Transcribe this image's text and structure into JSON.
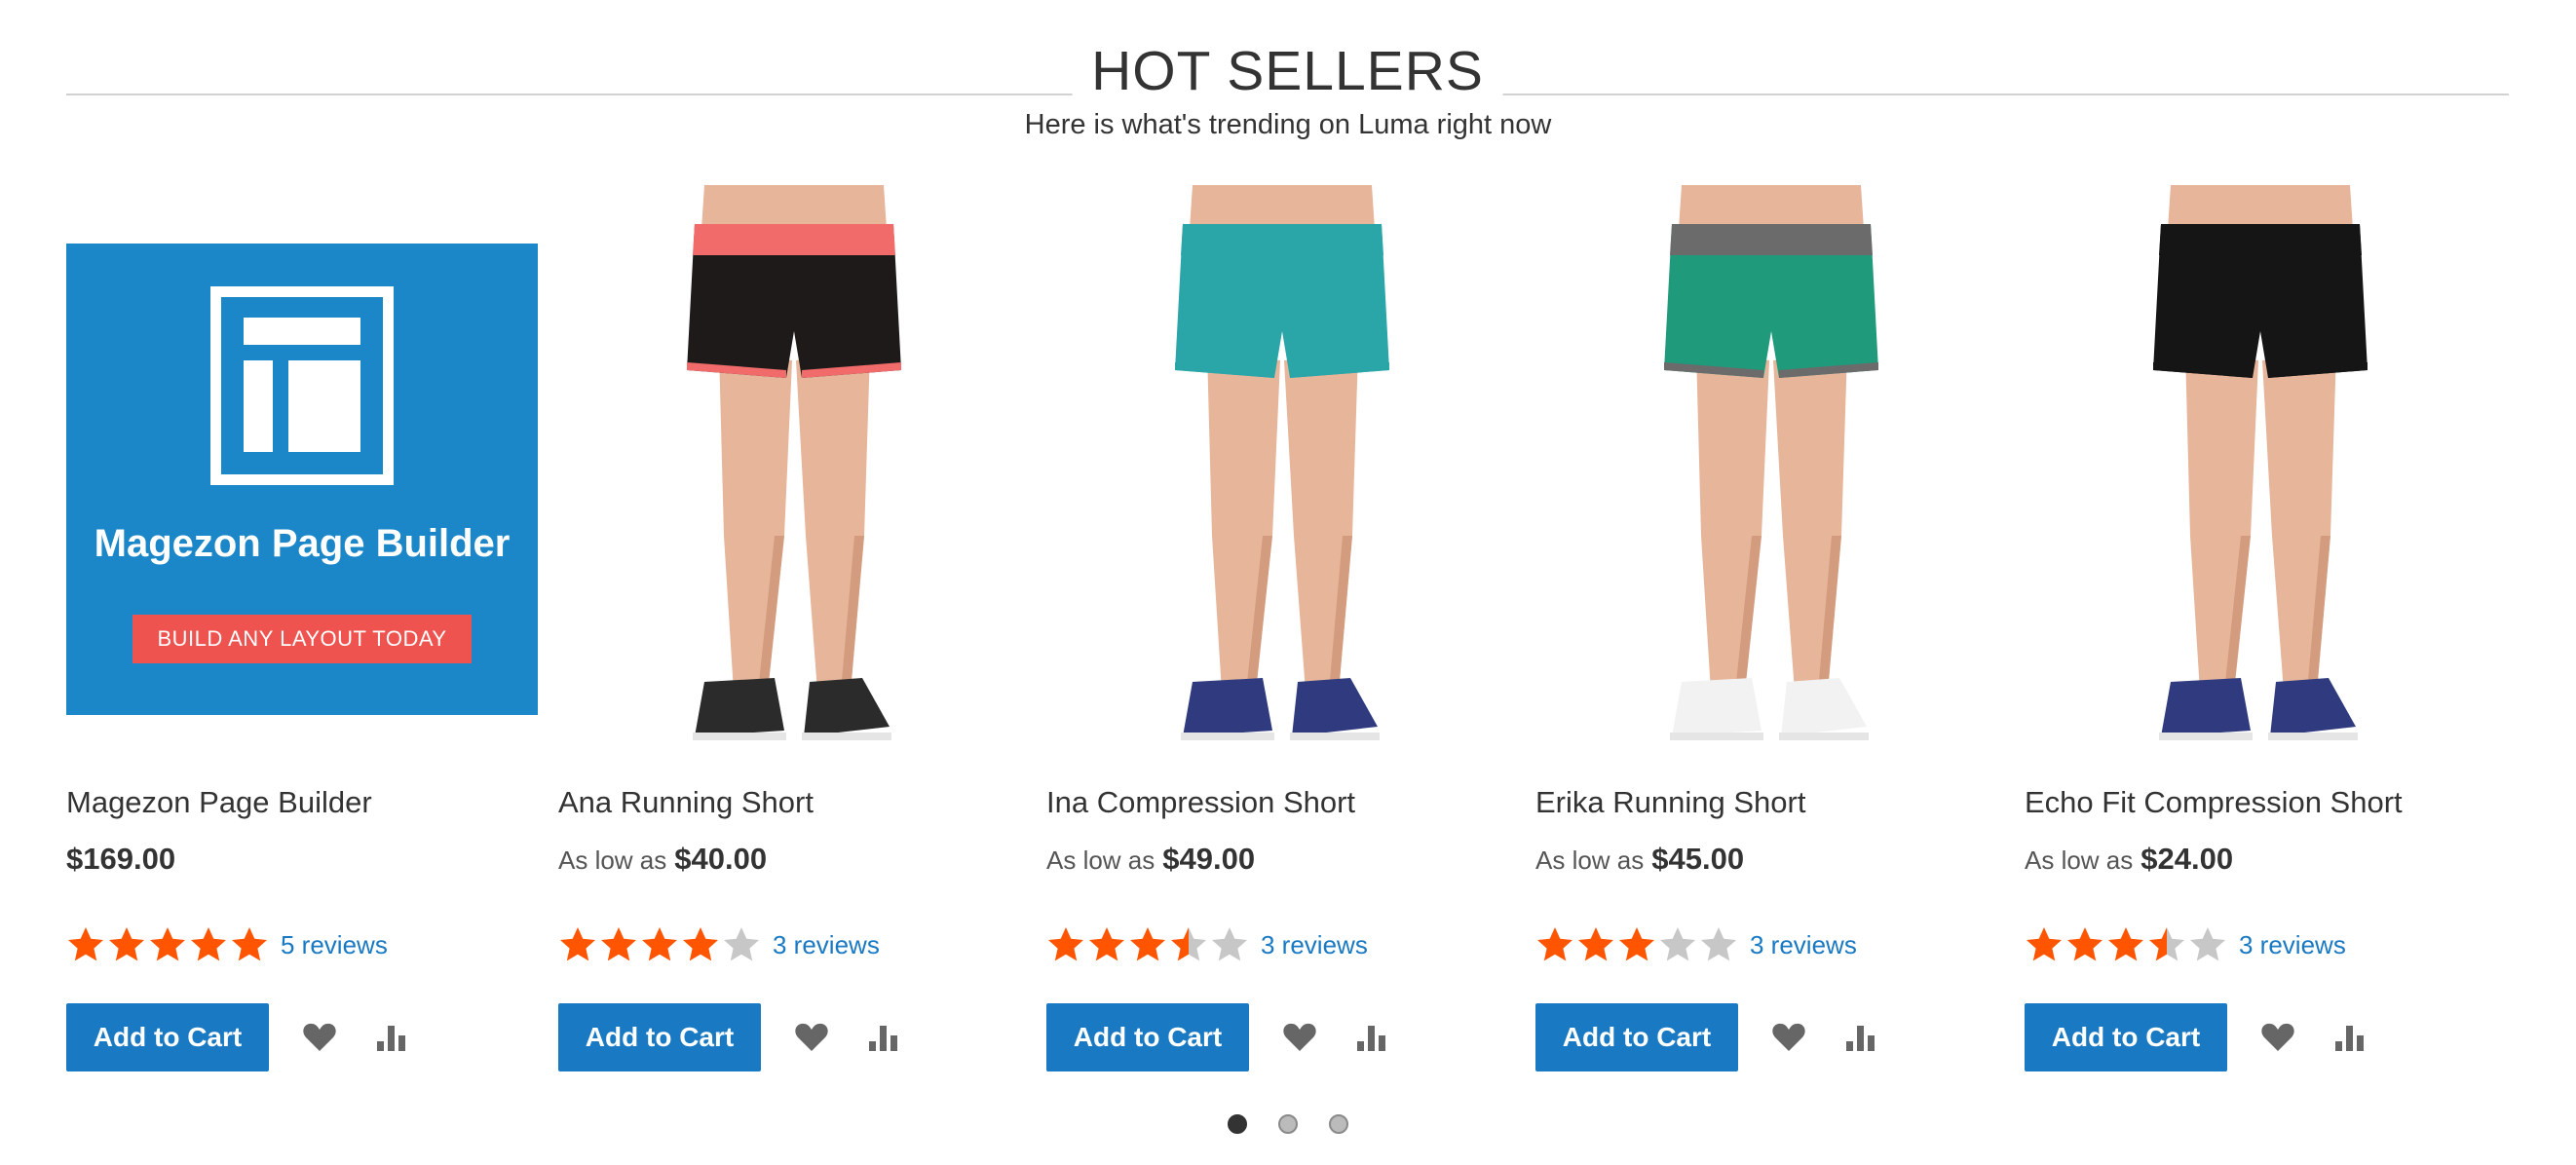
{
  "section": {
    "title": "HOT SELLERS",
    "subtitle": "Here is what's trending on Luma right now"
  },
  "colors": {
    "accent": "#1979c3",
    "star_filled": "#ff5501",
    "star_empty": "#c7c7c7",
    "banner_bg": "#1b86c8",
    "banner_cta": "#ef5350"
  },
  "products": [
    {
      "name": "Magezon Page Builder",
      "price_label": "",
      "price": "$169.00",
      "rating": 5,
      "reviews": "5 reviews",
      "add_to_cart": "Add to Cart",
      "banner": {
        "title": "Magezon Page Builder",
        "cta": "BUILD ANY LAYOUT TODAY"
      }
    },
    {
      "name": "Ana Running Short",
      "price_label": "As low as",
      "price": "$40.00",
      "rating": 4,
      "reviews": "3 reviews",
      "add_to_cart": "Add to Cart",
      "swatch": {
        "top": "#1f1a1a",
        "trim": "#f26b6b",
        "shoe": "#2b2b2b"
      }
    },
    {
      "name": "Ina Compression Short",
      "price_label": "As low as",
      "price": "$49.00",
      "rating": 3.5,
      "reviews": "3 reviews",
      "add_to_cart": "Add to Cart",
      "swatch": {
        "top": "#2aa6a8",
        "trim": "#2aa6a8",
        "shoe": "#2f3b7e"
      }
    },
    {
      "name": "Erika Running Short",
      "price_label": "As low as",
      "price": "$45.00",
      "rating": 3,
      "reviews": "3 reviews",
      "add_to_cart": "Add to Cart",
      "swatch": {
        "top": "#1f9a7a",
        "trim": "#6b6b6b",
        "shoe": "#f2f2f2"
      }
    },
    {
      "name": "Echo Fit Compression Short",
      "price_label": "As low as",
      "price": "$24.00",
      "rating": 3.5,
      "reviews": "3 reviews",
      "add_to_cart": "Add to Cart",
      "swatch": {
        "top": "#151515",
        "trim": "#151515",
        "shoe": "#2f3b7e"
      }
    }
  ],
  "icons": {
    "wishlist": "heart-icon",
    "compare": "bar-chart-icon"
  },
  "pager": {
    "pages": 3,
    "active": 1
  }
}
